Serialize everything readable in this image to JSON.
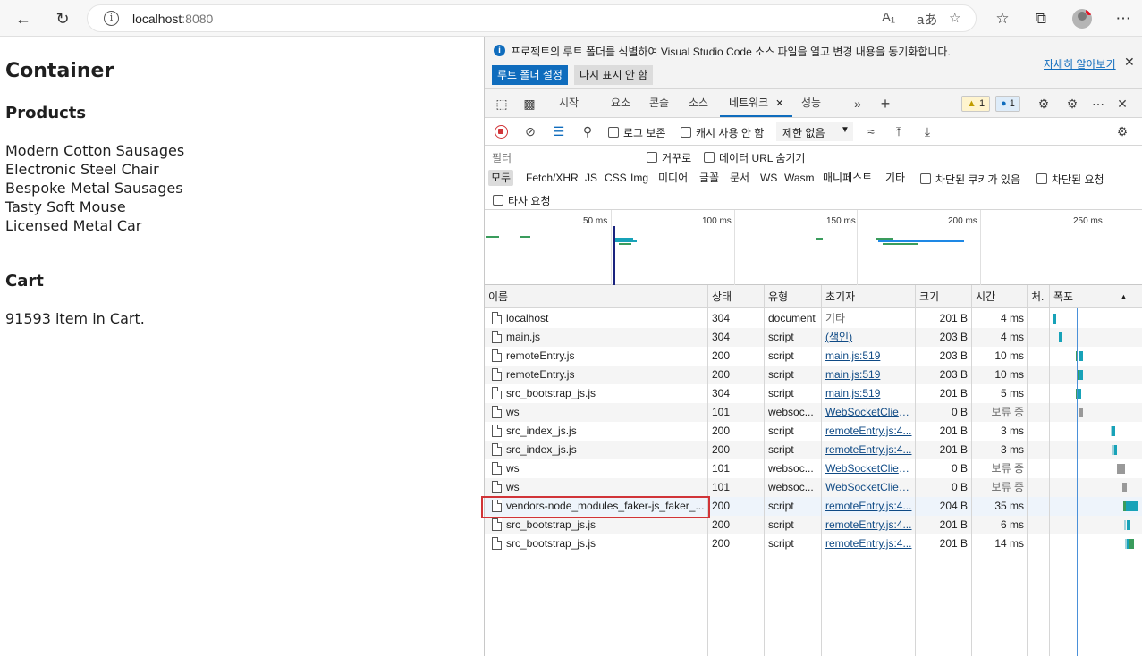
{
  "browser": {
    "url_host": "localhost",
    "url_port": ":8080",
    "icons": [
      "back-icon",
      "refresh-icon",
      "info-icon",
      "read-aloud-icon",
      "translate-icon",
      "add-favorite-icon",
      "favorites-icon",
      "collections-icon",
      "profile-icon",
      "more-icon"
    ]
  },
  "page": {
    "title": "Container",
    "products_heading": "Products",
    "products": [
      "Modern Cotton Sausages",
      "Electronic Steel Chair",
      "Bespoke Metal Sausages",
      "Tasty Soft Mouse",
      "Licensed Metal Car"
    ],
    "cart_heading": "Cart",
    "cart_text": "91593 item in Cart."
  },
  "devtools": {
    "infobar": {
      "message": "프로젝트의 루트 폴더를 식별하여 Visual Studio Code 소스 파일을 열고 변경 내용을 동기화합니다.",
      "set_root": "루트 폴더 설정",
      "dont_show": "다시 표시 안 함",
      "learn_more": "자세히 알아보기",
      "close": "✕"
    },
    "tabs": {
      "start": "시작",
      "elements": "요소",
      "console": "콘솔",
      "sources": "소스",
      "network": "네트워크",
      "performance": "성능",
      "close": "✕",
      "more": "»",
      "add": "+"
    },
    "badges": {
      "warnings": "1",
      "messages": "1"
    },
    "toolbar": {
      "preserve_log": "로그 보존",
      "disable_cache": "캐시 사용 안 함",
      "throttle": "제한 없음"
    },
    "filter": {
      "placeholder": "필터",
      "invert": "거꾸로",
      "hide_data_urls": "데이터 URL 숨기기",
      "types": [
        "모두",
        "Fetch/XHR",
        "JS",
        "CSS",
        "Img",
        "미디어",
        "글꼴",
        "문서",
        "WS",
        "Wasm",
        "매니페스트",
        "기타"
      ],
      "blocked_cookies": "차단된 쿠키가 있음",
      "blocked_requests": "차단된 요청",
      "third_party": "타사 요청"
    },
    "overview": {
      "ticks": [
        "50 ms",
        "100 ms",
        "150 ms",
        "200 ms",
        "250 ms"
      ]
    },
    "grid": {
      "headers": [
        "이름",
        "상태",
        "유형",
        "초기자",
        "크기",
        "시간",
        "처.",
        "폭포"
      ],
      "rows": [
        {
          "name": "localhost",
          "status": "304",
          "type": "document",
          "initiator": "기타",
          "size": "201 B",
          "time": "4 ms"
        },
        {
          "name": "main.js",
          "status": "304",
          "type": "script",
          "initiator": "(색인)",
          "size": "203 B",
          "time": "4 ms"
        },
        {
          "name": "remoteEntry.js",
          "status": "200",
          "type": "script",
          "initiator": "main.js:519",
          "size": "203 B",
          "time": "10 ms"
        },
        {
          "name": "remoteEntry.js",
          "status": "200",
          "type": "script",
          "initiator": "main.js:519",
          "size": "203 B",
          "time": "10 ms"
        },
        {
          "name": "src_bootstrap_js.js",
          "status": "304",
          "type": "script",
          "initiator": "main.js:519",
          "size": "201 B",
          "time": "5 ms"
        },
        {
          "name": "ws",
          "status": "101",
          "type": "websoc...",
          "initiator": "WebSocketClien...",
          "size": "0 B",
          "time": "보류 중"
        },
        {
          "name": "src_index_js.js",
          "status": "200",
          "type": "script",
          "initiator": "remoteEntry.js:4...",
          "size": "201 B",
          "time": "3 ms"
        },
        {
          "name": "src_index_js.js",
          "status": "200",
          "type": "script",
          "initiator": "remoteEntry.js:4...",
          "size": "201 B",
          "time": "3 ms"
        },
        {
          "name": "ws",
          "status": "101",
          "type": "websoc...",
          "initiator": "WebSocketClien...",
          "size": "0 B",
          "time": "보류 중"
        },
        {
          "name": "ws",
          "status": "101",
          "type": "websoc...",
          "initiator": "WebSocketClien...",
          "size": "0 B",
          "time": "보류 중"
        },
        {
          "name": "vendors-node_modules_faker-js_faker_...",
          "status": "200",
          "type": "script",
          "initiator": "remoteEntry.js:4...",
          "size": "204 B",
          "time": "35 ms"
        },
        {
          "name": "src_bootstrap_js.js",
          "status": "200",
          "type": "script",
          "initiator": "remoteEntry.js:4...",
          "size": "201 B",
          "time": "6 ms"
        },
        {
          "name": "src_bootstrap_js.js",
          "status": "200",
          "type": "script",
          "initiator": "remoteEntry.js:4...",
          "size": "201 B",
          "time": "14 ms"
        }
      ]
    }
  }
}
